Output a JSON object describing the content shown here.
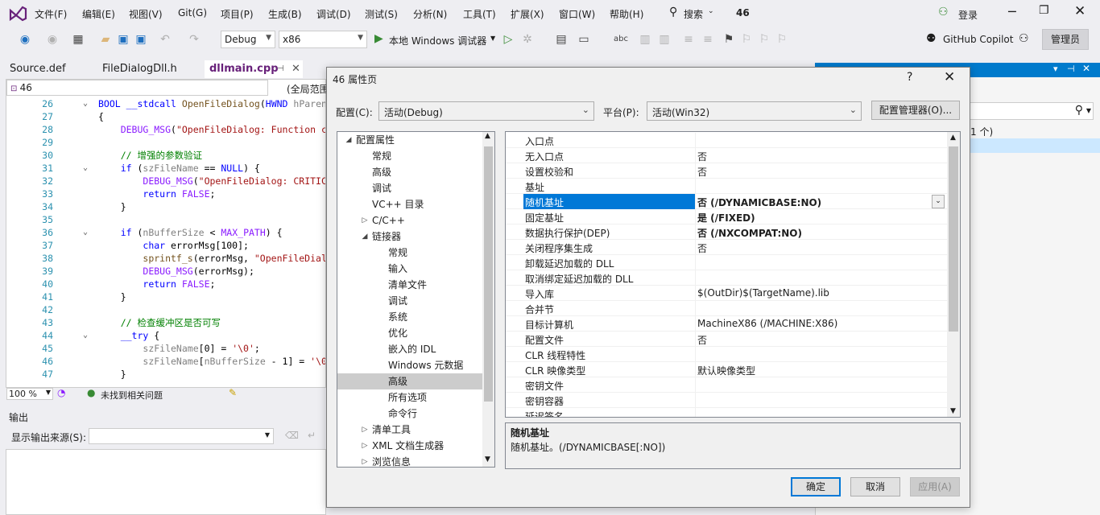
{
  "menu": {
    "items": [
      "文件(F)",
      "编辑(E)",
      "视图(V)",
      "Git(G)",
      "项目(P)",
      "生成(B)",
      "调试(D)",
      "测试(S)",
      "分析(N)",
      "工具(T)",
      "扩展(X)",
      "窗口(W)",
      "帮助(H)"
    ],
    "search": "搜索",
    "project_name": "46",
    "login": "登录"
  },
  "toolbar": {
    "config": "Debug",
    "platform": "x86",
    "run_label": "本地 Windows 调试器",
    "copilot": "GitHub Copilot",
    "admin": "管理员"
  },
  "tabs": [
    "Source.def",
    "FileDialogDll.h",
    "dllmain.cpp"
  ],
  "editor": {
    "nav_left": "46",
    "nav_right": "(全局范围",
    "zoom": "100 %",
    "status": "未找到相关问题",
    "lines": [
      {
        "n": "26",
        "fold": "⌄",
        "html": "<span class='kw'>BOOL</span> <span class='kw'>__stdcall</span> <span class='fn'>OpenFileDialog</span>(<span class='kw'>HWND</span> <span class='par'>hParen</span>"
      },
      {
        "n": "27",
        "fold": "",
        "html": "{"
      },
      {
        "n": "28",
        "fold": "",
        "html": "    <span class='mac'>DEBUG_MSG</span>(<span class='str'>\"OpenFileDialog: Function c</span>"
      },
      {
        "n": "29",
        "fold": "",
        "html": ""
      },
      {
        "n": "30",
        "fold": "",
        "html": "    <span class='cm'>// 增强的参数验证</span>"
      },
      {
        "n": "31",
        "fold": "⌄",
        "html": "    <span class='kw'>if</span> (<span class='par'>szFileName</span> == <span class='kw'>NULL</span>) {"
      },
      {
        "n": "32",
        "fold": "",
        "html": "        <span class='mac'>DEBUG_MSG</span>(<span class='str'>\"OpenFileDialog: CRITIC</span>"
      },
      {
        "n": "33",
        "fold": "",
        "html": "        <span class='kw'>return</span> <span class='mac'>FALSE</span>;"
      },
      {
        "n": "34",
        "fold": "",
        "html": "    }"
      },
      {
        "n": "35",
        "fold": "",
        "html": ""
      },
      {
        "n": "36",
        "fold": "⌄",
        "html": "    <span class='kw'>if</span> (<span class='par'>nBufferSize</span> &lt; <span class='mac'>MAX_PATH</span>) {"
      },
      {
        "n": "37",
        "fold": "",
        "html": "        <span class='kw'>char</span> errorMsg[100];"
      },
      {
        "n": "38",
        "fold": "",
        "html": "        <span class='fn'>sprintf_s</span>(errorMsg, <span class='str'>\"OpenFileDial</span>"
      },
      {
        "n": "39",
        "fold": "",
        "html": "        <span class='mac'>DEBUG_MSG</span>(errorMsg);"
      },
      {
        "n": "40",
        "fold": "",
        "html": "        <span class='kw'>return</span> <span class='mac'>FALSE</span>;"
      },
      {
        "n": "41",
        "fold": "",
        "html": "    }"
      },
      {
        "n": "42",
        "fold": "",
        "html": ""
      },
      {
        "n": "43",
        "fold": "",
        "html": "    <span class='cm'>// 检查缓冲区是否可写</span>"
      },
      {
        "n": "44",
        "fold": "⌄",
        "html": "    <span class='kw'>__try</span> {"
      },
      {
        "n": "45",
        "fold": "",
        "html": "        <span class='par'>szFileName</span>[0] = <span class='str'>'\\0'</span>;"
      },
      {
        "n": "46",
        "fold": "",
        "html": "        <span class='par'>szFileName</span>[<span class='par'>nBufferSize</span> - 1] = <span class='str'>'\\0</span>"
      },
      {
        "n": "47",
        "fold": "",
        "html": "    }"
      }
    ]
  },
  "output": {
    "title": "输出",
    "source_label": "显示输出来源(S):"
  },
  "right_panel": {
    "count": "1 个)"
  },
  "dialog": {
    "title": "46 属性页",
    "help": "?",
    "config_label": "配置(C):",
    "config_value": "活动(Debug)",
    "platform_label": "平台(P):",
    "platform_value": "活动(Win32)",
    "config_manager": "配置管理器(O)...",
    "tree": [
      {
        "label": "配置属性",
        "level": 0,
        "exp": "◢"
      },
      {
        "label": "常规",
        "level": 1,
        "exp": ""
      },
      {
        "label": "高级",
        "level": 1,
        "exp": ""
      },
      {
        "label": "调试",
        "level": 1,
        "exp": ""
      },
      {
        "label": "VC++ 目录",
        "level": 1,
        "exp": ""
      },
      {
        "label": "C/C++",
        "level": 1,
        "exp": "▷"
      },
      {
        "label": "链接器",
        "level": 1,
        "exp": "◢"
      },
      {
        "label": "常规",
        "level": 2,
        "exp": ""
      },
      {
        "label": "输入",
        "level": 2,
        "exp": ""
      },
      {
        "label": "清单文件",
        "level": 2,
        "exp": ""
      },
      {
        "label": "调试",
        "level": 2,
        "exp": ""
      },
      {
        "label": "系统",
        "level": 2,
        "exp": ""
      },
      {
        "label": "优化",
        "level": 2,
        "exp": ""
      },
      {
        "label": "嵌入的 IDL",
        "level": 2,
        "exp": ""
      },
      {
        "label": "Windows 元数据",
        "level": 2,
        "exp": ""
      },
      {
        "label": "高级",
        "level": 2,
        "exp": "",
        "sel": true
      },
      {
        "label": "所有选项",
        "level": 2,
        "exp": ""
      },
      {
        "label": "命令行",
        "level": 2,
        "exp": ""
      },
      {
        "label": "清单工具",
        "level": 1,
        "exp": "▷"
      },
      {
        "label": "XML 文档生成器",
        "level": 1,
        "exp": "▷"
      },
      {
        "label": "浏览信息",
        "level": 1,
        "exp": "▷"
      }
    ],
    "props": [
      {
        "name": "入口点",
        "value": ""
      },
      {
        "name": "无入口点",
        "value": "否"
      },
      {
        "name": "设置校验和",
        "value": "否"
      },
      {
        "name": "基址",
        "value": ""
      },
      {
        "name": "随机基址",
        "value": "否 (/DYNAMICBASE:NO)",
        "sel": true,
        "bold": true
      },
      {
        "name": "固定基址",
        "value": "是 (/FIXED)",
        "bold": true
      },
      {
        "name": "数据执行保护(DEP)",
        "value": "否 (/NXCOMPAT:NO)",
        "bold": true
      },
      {
        "name": "关闭程序集生成",
        "value": "否"
      },
      {
        "name": "卸载延迟加载的 DLL",
        "value": ""
      },
      {
        "name": "取消绑定延迟加载的 DLL",
        "value": ""
      },
      {
        "name": "导入库",
        "value": "$(OutDir)$(TargetName).lib"
      },
      {
        "name": "合并节",
        "value": ""
      },
      {
        "name": "目标计算机",
        "value": "MachineX86 (/MACHINE:X86)"
      },
      {
        "name": "配置文件",
        "value": "否"
      },
      {
        "name": "CLR 线程特性",
        "value": ""
      },
      {
        "name": "CLR 映像类型",
        "value": "默认映像类型"
      },
      {
        "name": "密钥文件",
        "value": ""
      },
      {
        "name": "密钥容器",
        "value": ""
      },
      {
        "name": "延迟签名",
        "value": ""
      }
    ],
    "desc_title": "随机基址",
    "desc_text": "随机基址。(/DYNAMICBASE[:NO])",
    "ok": "确定",
    "cancel": "取消",
    "apply": "应用(A)"
  }
}
